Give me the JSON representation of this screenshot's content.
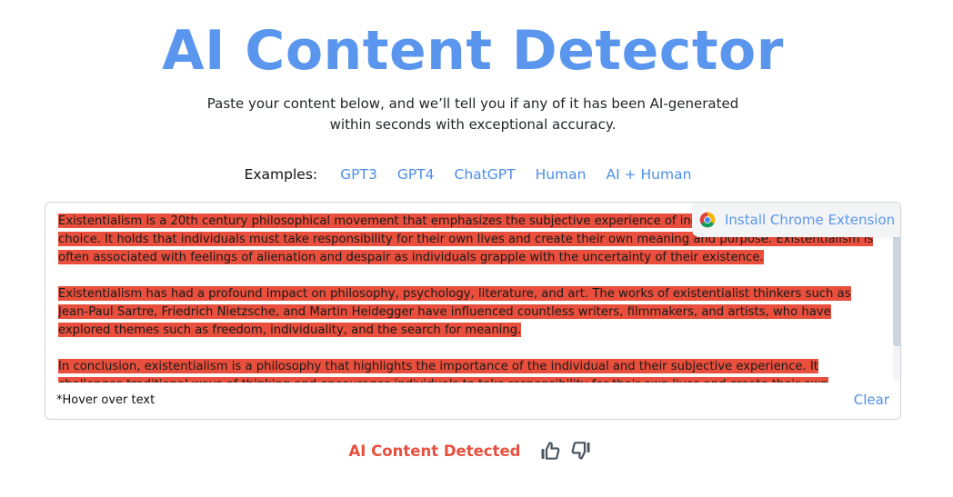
{
  "header": {
    "title": "AI Content Detector",
    "subtitle": "Paste your content below, and we’ll tell you if any of it has been AI-generated within seconds with exceptional accuracy."
  },
  "examples": {
    "label": "Examples:",
    "items": [
      {
        "label": "GPT3"
      },
      {
        "label": "GPT4"
      },
      {
        "label": "ChatGPT"
      },
      {
        "label": "Human"
      },
      {
        "label": "AI + Human"
      }
    ]
  },
  "editor": {
    "paragraphs": [
      "Existentialism is a 20th century philosophical movement that emphasizes the subjective experience of individuals and their freedom of choice. It holds that individuals must take responsibility for their own lives and create their own meaning and purpose. Existentialism is often associated with feelings of alienation and despair as individuals grapple with the uncertainty of their existence.",
      "Existentialism has had a profound impact on philosophy, psychology, literature, and art. The works of existentialist thinkers such as Jean-Paul Sartre, Friedrich Nietzsche, and Martin Heidegger have influenced countless writers, filmmakers, and artists, who have explored themes such as freedom, individuality, and the search for meaning.",
      "In conclusion, existentialism is a philosophy that highlights the importance of the individual and their subjective experience. It challenges traditional ways of thinking and encourages individuals to take responsibility for their own lives and create their own meaning and purpose."
    ],
    "highlight_color": "#e94f3c",
    "hint": "*Hover over text",
    "clear_label": "Clear",
    "scroll_position": 0.0
  },
  "chrome_extension": {
    "label": "Install Chrome Extension",
    "icon": "chrome-icon"
  },
  "result": {
    "label": "AI Content Detected",
    "color": "#e6503f",
    "feedback": [
      {
        "icon": "thumbs-up-icon"
      },
      {
        "icon": "thumbs-down-icon"
      }
    ]
  },
  "colors": {
    "accent": "#5a96ee",
    "link": "#4d8fe8",
    "detected": "#e6503f"
  }
}
